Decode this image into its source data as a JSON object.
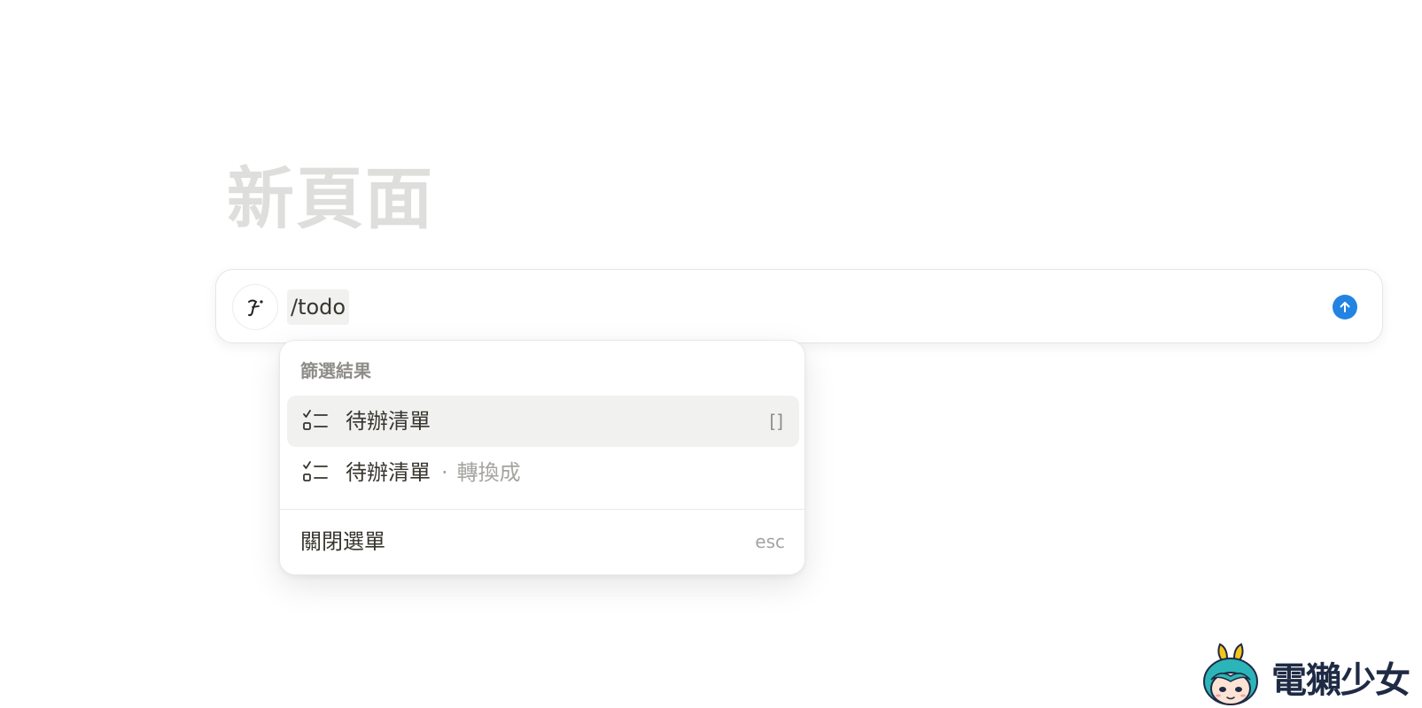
{
  "page": {
    "title": "新頁面"
  },
  "command_bar": {
    "avatar_icon": "notion-ai-face-icon",
    "input_value": "/todo",
    "submit_icon": "arrow-up-icon",
    "accent_color": "#2383e2"
  },
  "menu": {
    "section_label": "篩選結果",
    "items": [
      {
        "icon": "todo-checklist-icon",
        "label": "待辦清單",
        "shortcut": "[]",
        "selected": true
      },
      {
        "icon": "todo-checklist-icon",
        "label": "待辦清單",
        "separator": "·",
        "suffix": "轉換成",
        "selected": false
      }
    ],
    "close": {
      "label": "關閉選單",
      "shortcut": "esc"
    }
  },
  "watermark": {
    "text": "電獺少女",
    "mascot_icon": "otter-girl-mascot-icon"
  }
}
